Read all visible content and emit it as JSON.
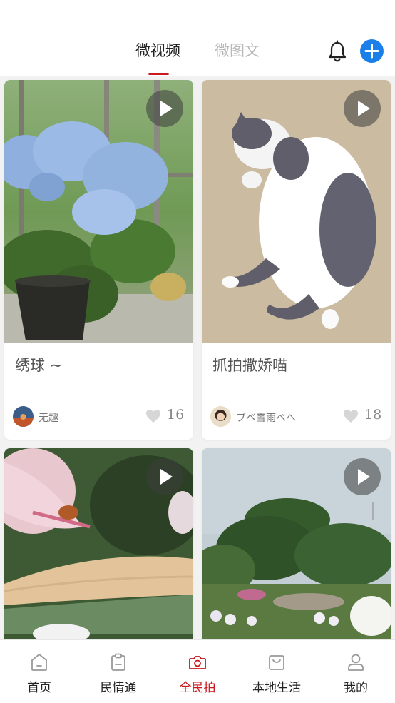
{
  "header": {
    "tabs": [
      {
        "label": "微视频",
        "active": true
      },
      {
        "label": "微图文",
        "active": false
      }
    ],
    "accent_color": "#c8191e",
    "add_button_color": "#1a7fe8"
  },
  "feed": {
    "cards": [
      {
        "title": "绣球 ~",
        "author": "无趣",
        "likes": "16",
        "has_video": true,
        "image": "hydrangea-photo"
      },
      {
        "title": "抓拍撒娇喵",
        "author": "ブベ雪雨ベへ",
        "likes": "18",
        "has_video": true,
        "image": "cat-photo"
      },
      {
        "title": "",
        "author": "",
        "likes": "",
        "has_video": true,
        "image": "lily-photo"
      },
      {
        "title": "",
        "author": "",
        "likes": "",
        "has_video": true,
        "image": "garden-photo"
      }
    ]
  },
  "bottom_nav": {
    "items": [
      {
        "label": "首页",
        "icon": "home-icon",
        "active": false
      },
      {
        "label": "民情通",
        "icon": "clipboard-icon",
        "active": false
      },
      {
        "label": "全民拍",
        "icon": "camera-icon",
        "active": true
      },
      {
        "label": "本地生活",
        "icon": "shopping-bag-icon",
        "active": false
      },
      {
        "label": "我的",
        "icon": "user-icon",
        "active": false
      }
    ]
  }
}
